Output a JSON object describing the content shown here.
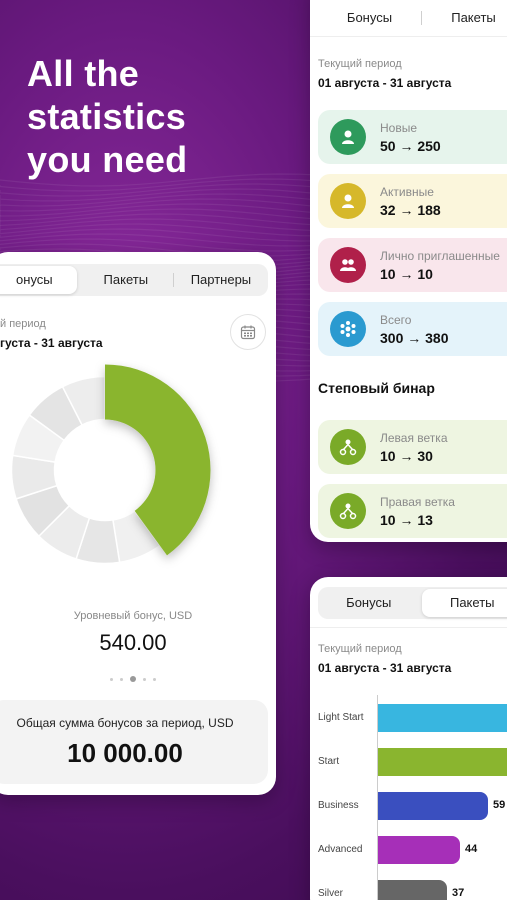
{
  "headline": [
    "All the",
    "statistics",
    "you need"
  ],
  "colors": {
    "green": "#8ab52f",
    "purple_bg": "#6a1a80"
  },
  "card_right_top": {
    "tabs": [
      {
        "label": "Бонусы"
      },
      {
        "label": "Пакеты"
      }
    ],
    "period_label": "Текущий период",
    "period_value": "01 августа - 31 августа",
    "stats": [
      {
        "label": "Новые",
        "value": "50 → 250",
        "icon": "person-icon",
        "color": "#2e9a5c",
        "bg": "#e6f4ec"
      },
      {
        "label": "Активные",
        "value": "32 → 188",
        "icon": "person-icon",
        "color": "#d6b82a",
        "bg": "#fbf6dc"
      },
      {
        "label": "Лично приглашенные",
        "value": "10 → 10",
        "icon": "group-icon",
        "color": "#b0204a",
        "bg": "#f9e6ec"
      },
      {
        "label": "Всего",
        "value": "300 → 380",
        "icon": "network-icon",
        "color": "#2a9ad0",
        "bg": "#e4f3fa"
      }
    ],
    "section_title": "Степовый бинар",
    "branches": [
      {
        "label": "Левая ветка",
        "value": "10 → 30",
        "icon": "tree-icon",
        "color": "#7aaa28",
        "bg": "#eef5e1"
      },
      {
        "label": "Правая ветка",
        "value": "10 → 13",
        "icon": "tree-icon",
        "color": "#7aaa28",
        "bg": "#eef5e1"
      }
    ]
  },
  "card_left": {
    "tabs": [
      {
        "label": "онусы"
      },
      {
        "label": "Пакеты"
      },
      {
        "label": "Партнеры"
      }
    ],
    "period_label": "й период",
    "period_value": "густа - 31 августа",
    "donut": {
      "highlight_fraction": 0.4,
      "caption": "Уровневый бонус, USD",
      "value": "540.00"
    },
    "total_label": "Общая сумма бонусов за период, USD",
    "total_value": "10 000.00"
  },
  "card_right_bottom": {
    "tabs": [
      {
        "label": "Бонусы"
      },
      {
        "label": "Пакеты"
      }
    ],
    "period_label": "Текущий период",
    "period_value": "01 августа - 31 августа"
  },
  "chart_data": {
    "type": "bar",
    "orientation": "horizontal",
    "categories": [
      "Light Start",
      "Start",
      "Business",
      "Advanced",
      "Silver"
    ],
    "values": [
      null,
      null,
      59,
      44,
      37
    ],
    "value_labels": [
      "",
      "",
      "59",
      "44",
      "37"
    ],
    "colors": [
      "#38b6e0",
      "#8ab52f",
      "#3a4fbf",
      "#a62fb8",
      "#666666"
    ]
  }
}
